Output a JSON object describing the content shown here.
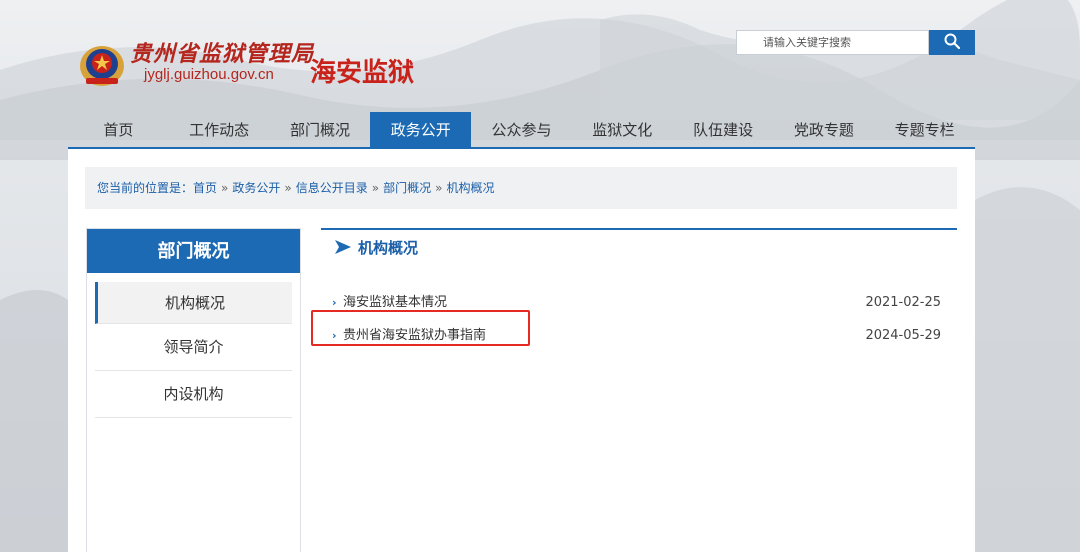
{
  "header": {
    "bureau_name": "贵州省监狱管理局",
    "domain": "jyglj.guizhou.gov.cn",
    "prison_name": "海安监狱"
  },
  "search": {
    "placeholder": "请输入关键字搜索",
    "icon": "search-icon"
  },
  "nav": {
    "items": [
      {
        "label": "首页"
      },
      {
        "label": "工作动态"
      },
      {
        "label": "部门概况"
      },
      {
        "label": "政务公开",
        "active": true
      },
      {
        "label": "公众参与"
      },
      {
        "label": "监狱文化"
      },
      {
        "label": "队伍建设"
      },
      {
        "label": "党政专题"
      },
      {
        "label": "专题专栏"
      }
    ]
  },
  "breadcrumb": {
    "prefix": "您当前的位置是：",
    "items": [
      "首页",
      "政务公开",
      "信息公开目录",
      "部门概况",
      "机构概况"
    ],
    "separator": "»"
  },
  "sidebar": {
    "title": "部门概况",
    "items": [
      {
        "label": "机构概况",
        "active": true
      },
      {
        "label": "领导简介"
      },
      {
        "label": "内设机构"
      }
    ]
  },
  "content": {
    "title": "机构概况",
    "items": [
      {
        "title": "海安监狱基本情况",
        "date": "2021-02-25"
      },
      {
        "title": "贵州省海安监狱办事指南",
        "date": "2024-05-29"
      }
    ]
  },
  "colors": {
    "brand_blue": "#1b6ab3",
    "logo_red": "#c8221b",
    "highlight_red": "#e52a24"
  }
}
